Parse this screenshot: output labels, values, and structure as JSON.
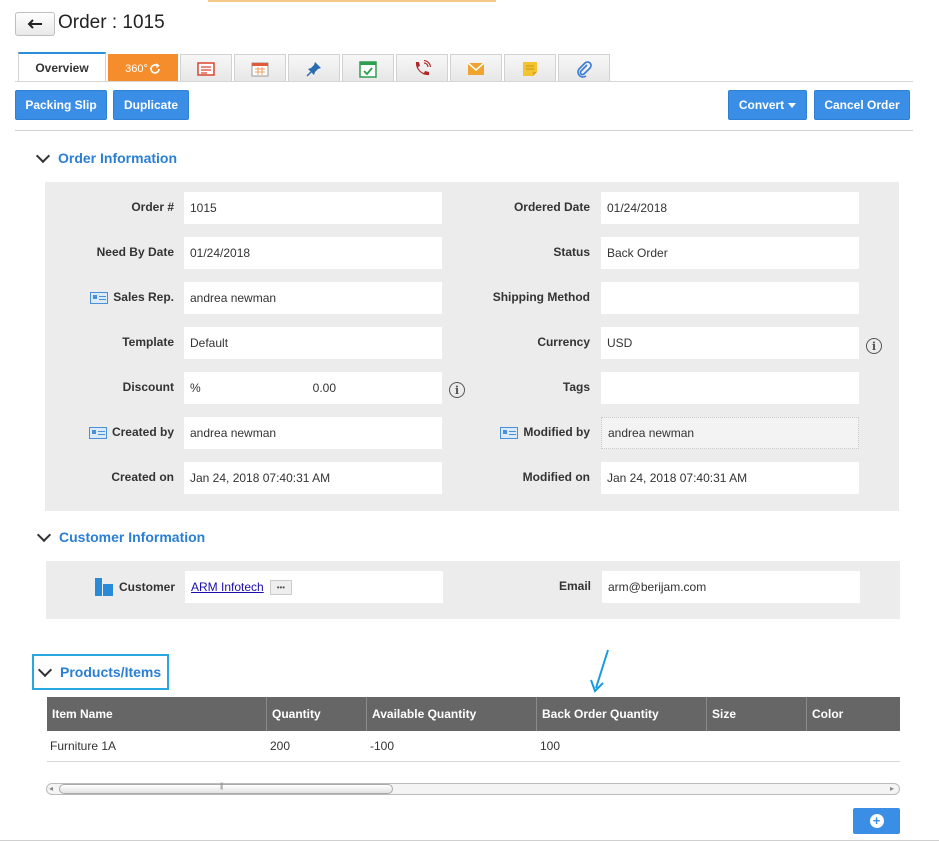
{
  "header": {
    "title": "Order : 1015",
    "back_icon": "back-arrow-icon"
  },
  "tabs": [
    {
      "label": "Overview",
      "icon": null
    },
    {
      "label": "360°",
      "icon": "refresh-icon"
    },
    {
      "label": "",
      "icon": "invoice-icon"
    },
    {
      "label": "",
      "icon": "calendar-icon"
    },
    {
      "label": "",
      "icon": "pin-icon"
    },
    {
      "label": "",
      "icon": "task-check-icon"
    },
    {
      "label": "",
      "icon": "phone-call-icon"
    },
    {
      "label": "",
      "icon": "mail-icon"
    },
    {
      "label": "",
      "icon": "note-icon"
    },
    {
      "label": "",
      "icon": "paperclip-icon"
    }
  ],
  "toolbar": {
    "packing_slip": "Packing Slip",
    "duplicate": "Duplicate",
    "convert": "Convert",
    "cancel_order": "Cancel Order"
  },
  "order_info": {
    "title": "Order Information",
    "order_no_label": "Order #",
    "order_no": "1015",
    "ordered_date_label": "Ordered Date",
    "ordered_date": "01/24/2018",
    "need_by_label": "Need By Date",
    "need_by": "01/24/2018",
    "status_label": "Status",
    "status": "Back Order",
    "sales_rep_label": "Sales Rep.",
    "sales_rep": "andrea newman",
    "shipping_label": "Shipping Method",
    "shipping": "",
    "template_label": "Template",
    "template": "Default",
    "currency_label": "Currency",
    "currency": "USD",
    "discount_label": "Discount",
    "discount_unit": "%",
    "discount_value": "0.00",
    "tags_label": "Tags",
    "tags": "",
    "created_by_label": "Created by",
    "created_by": "andrea newman",
    "modified_by_label": "Modified by",
    "modified_by": "andrea newman",
    "created_on_label": "Created on",
    "created_on": "Jan 24, 2018 07:40:31 AM",
    "modified_on_label": "Modified on",
    "modified_on": "Jan 24, 2018 07:40:31 AM"
  },
  "customer_info": {
    "title": "Customer Information",
    "customer_label": "Customer",
    "customer": "ARM Infotech",
    "more": "•••",
    "email_label": "Email",
    "email": "arm@berijam.com"
  },
  "products": {
    "title": "Products/Items",
    "columns": [
      "Item Name",
      "Quantity",
      "Available Quantity",
      "Back Order Quantity",
      "Size",
      "Color"
    ],
    "rows": [
      [
        "Furniture 1A",
        "200",
        "-100",
        "100",
        "",
        ""
      ]
    ],
    "scroll_grip": "|||"
  },
  "colors": {
    "primary": "#3b8ee5",
    "accent_orange": "#f58d2c",
    "header_bg": "#666666",
    "highlight": "#29a8e0"
  }
}
